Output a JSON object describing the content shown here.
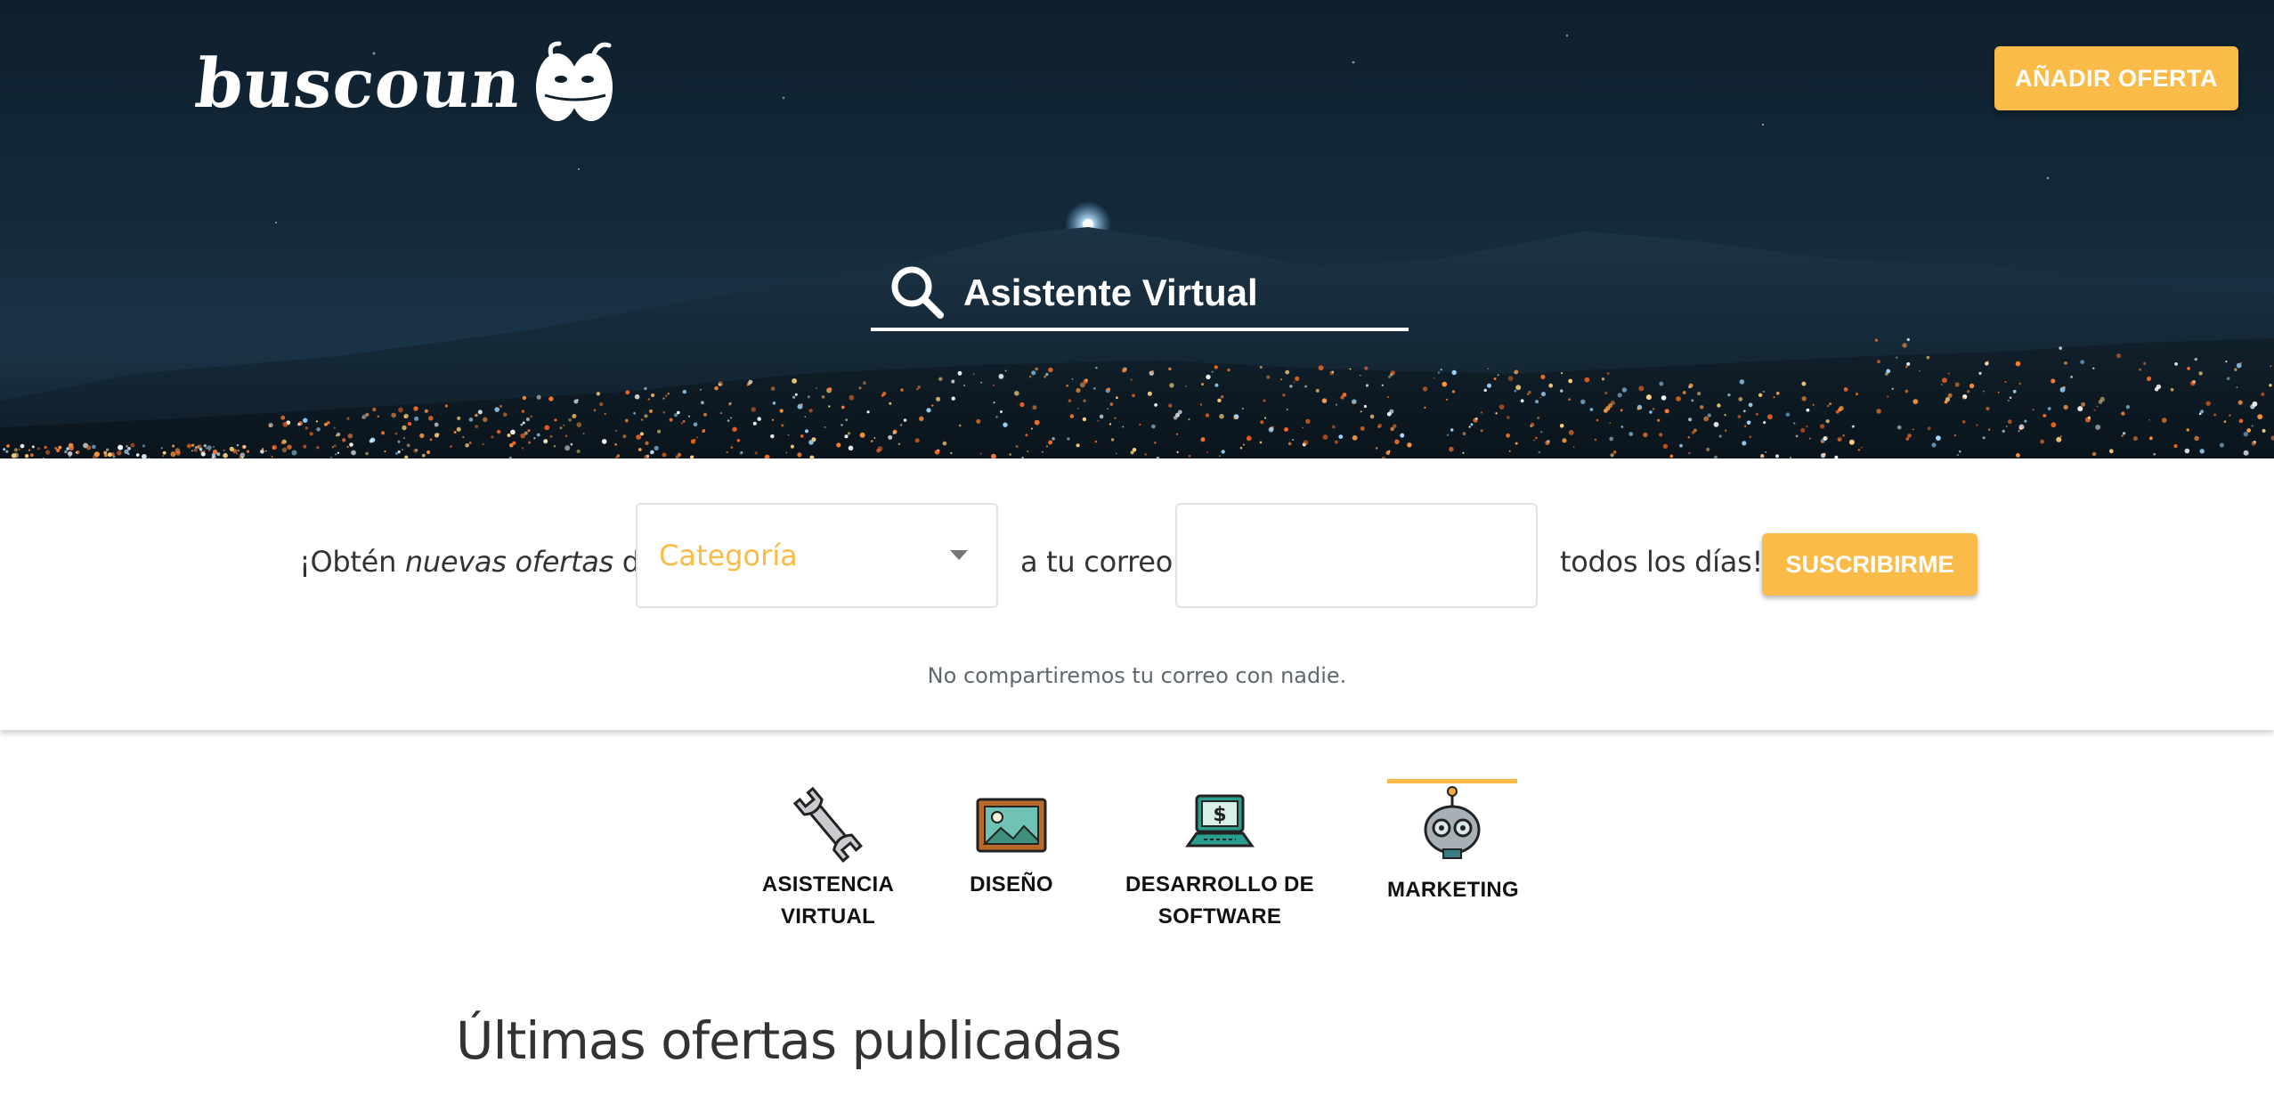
{
  "header": {
    "logo_text": "buscoun",
    "add_offer_label": "AÑADIR OFERTA"
  },
  "search": {
    "value": "Asistente Virtual",
    "icon": "search-icon"
  },
  "subscribe": {
    "prefix_1": "¡Obtén ",
    "prefix_em": "nuevas ofertas",
    "prefix_2": " de",
    "category_value": "Categoría",
    "middle_text": "a tu correo",
    "email_value": "",
    "suffix_text": "todos los días!",
    "button_label": "SUSCRIBIRME",
    "note": "No compartiremos tu correo con nadie."
  },
  "categories": [
    {
      "label_1": "ASISTENCIA",
      "label_2": "VIRTUAL",
      "icon": "wrench-icon",
      "active": false
    },
    {
      "label_1": "DISEÑO",
      "label_2": "",
      "icon": "picture-icon",
      "active": false
    },
    {
      "label_1": "DESARROLLO DE",
      "label_2": "SOFTWARE",
      "icon": "laptop-dollar-icon",
      "active": false
    },
    {
      "label_1": "MARKETING",
      "label_2": "",
      "icon": "robot-icon",
      "active": true
    }
  ],
  "main": {
    "section_title": "Últimas ofertas publicadas"
  },
  "colors": {
    "accent": "#fbbb48",
    "hero_sky": "#13293a",
    "text_dark": "#333333"
  }
}
